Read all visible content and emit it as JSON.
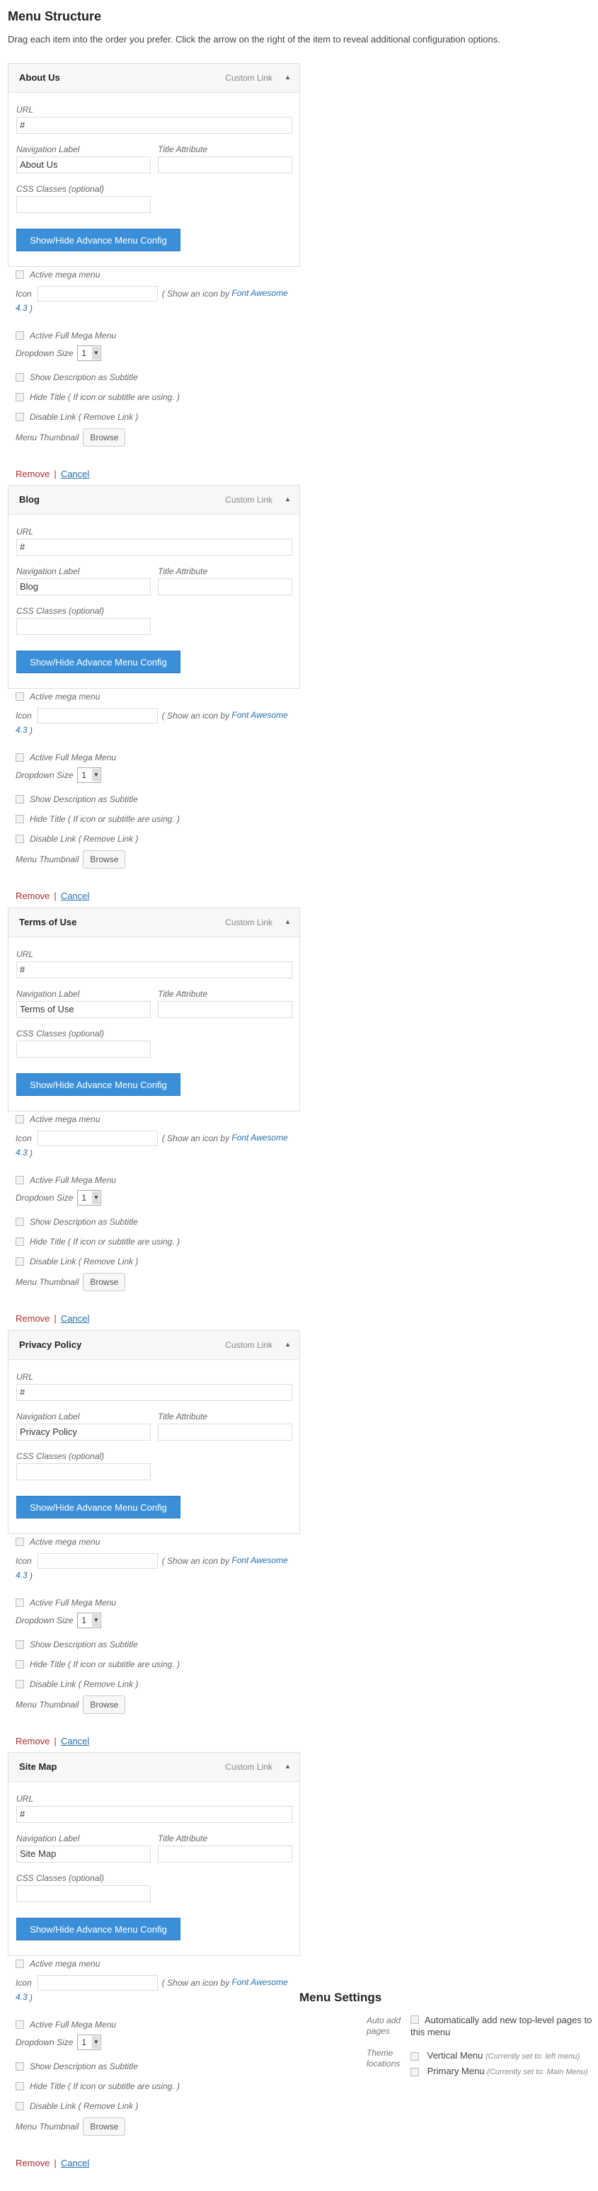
{
  "page": {
    "title": "Menu Structure",
    "intro": "Drag each item into the order you prefer. Click the arrow on the right of the item to reveal additional configuration options."
  },
  "labels": {
    "type": "Custom Link",
    "url": "URL",
    "nav_label": "Navigation Label",
    "title_attr": "Title Attribute",
    "css": "CSS Classes (optional)",
    "config_button": "Show/Hide Advance Menu Config",
    "mega": "Active mega menu",
    "icon": "Icon",
    "icon_hint": "( Show an icon by ",
    "icon_link": "Font Awesome",
    "icon_version": "4.3",
    "icon_close": " )",
    "full_mega": "Active Full Mega Menu",
    "dropdown_size": "Dropdown Size",
    "dropdown_value": "1",
    "desc_subtitle": "Show Description as Subtitle",
    "hide_title": "Hide Title ( If icon or subtitle are using. )",
    "disable_link": "Disable Link ( Remove Link )",
    "thumbnail": "Menu Thumbnail",
    "browse": "Browse",
    "remove": "Remove",
    "separator": "|",
    "cancel": "Cancel"
  },
  "items": [
    {
      "name": "About Us",
      "url": "#",
      "nav_label": "About Us",
      "title_attr": "",
      "css": ""
    },
    {
      "name": "Blog",
      "url": "#",
      "nav_label": "Blog",
      "title_attr": "",
      "css": ""
    },
    {
      "name": "Terms of Use",
      "url": "#",
      "nav_label": "Terms of Use",
      "title_attr": "",
      "css": ""
    },
    {
      "name": "Privacy Policy",
      "url": "#",
      "nav_label": "Privacy Policy",
      "title_attr": "",
      "css": ""
    },
    {
      "name": "Site Map",
      "url": "#",
      "nav_label": "Site Map",
      "title_attr": "",
      "css": ""
    }
  ],
  "settings": {
    "title": "Menu Settings",
    "auto_add_label": "Auto add pages",
    "auto_add_text": "Automatically add new top-level pages to this menu",
    "theme_locations_label": "Theme locations",
    "locations": [
      {
        "name": "Vertical Menu",
        "current": "(Currently set to: left menu)"
      },
      {
        "name": "Primary Menu",
        "current": "(Currently set to: Main Menu)"
      }
    ]
  },
  "colors": {
    "accent": "#3a8fd8",
    "remove": "#b32d2e",
    "link": "#2271b1"
  }
}
